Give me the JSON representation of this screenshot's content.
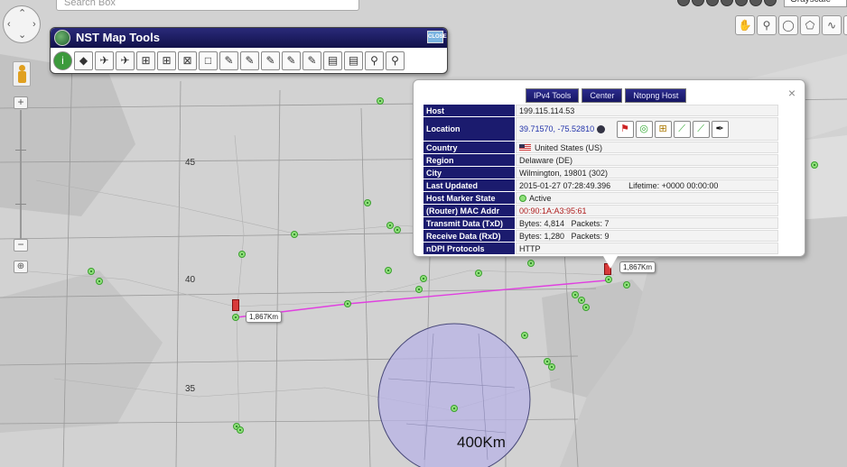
{
  "search": {
    "placeholder": "Search Box"
  },
  "map_type": {
    "selected": "Grayscale"
  },
  "nst_panel": {
    "title": "NST Map Tools",
    "close_label": "CLOSE",
    "tools": [
      "info-icon",
      "marker-icon",
      "plane-icon",
      "plane-icon",
      "trace-icon",
      "trace-icon",
      "trace-icon",
      "box-icon",
      "pencil-icon",
      "pencil-icon",
      "pencil-icon",
      "pencil-icon",
      "pencil-icon",
      "document-icon",
      "document-icon",
      "magnify-icon",
      "magnify-icon"
    ]
  },
  "lat_labels": [
    "45",
    "40",
    "35"
  ],
  "distance_labels": {
    "left": "1,867Km",
    "right": "1,867Km"
  },
  "circle": {
    "label": "400Km",
    "fill": "#b8b3e6"
  },
  "route": {
    "color": "#e040e0"
  },
  "popup": {
    "tabs": [
      "IPv4 Tools",
      "Center",
      "Ntopng Host"
    ],
    "close": "×",
    "rows": {
      "host": {
        "key": "Host",
        "value": "199.115.114.53"
      },
      "location": {
        "key": "Location",
        "value": "39.71570, -75.52810"
      },
      "country": {
        "key": "Country",
        "value": "United States (US)"
      },
      "region": {
        "key": "Region",
        "value": "Delaware (DE)"
      },
      "city": {
        "key": "City",
        "value": "Wilmington, 19801 (302)"
      },
      "last_updated": {
        "key": "Last Updated",
        "value": "2015-01-27 07:28:49.396",
        "lifetime": "Lifetime: +0000 00:00:00"
      },
      "marker_state": {
        "key": "Host Marker State",
        "value": "Active"
      },
      "mac": {
        "key": "(Router) MAC Addr",
        "value": "00:90:1A:A3:95:61"
      },
      "txd": {
        "key": "Transmit Data (TxD)",
        "value": "Bytes: 4,814   Packets: 7"
      },
      "rxd": {
        "key": "Receive Data (RxD)",
        "value": "Bytes: 1,280   Packets: 9"
      },
      "ndpi": {
        "key": "nDPI Protocols",
        "value": "HTTP"
      }
    }
  }
}
